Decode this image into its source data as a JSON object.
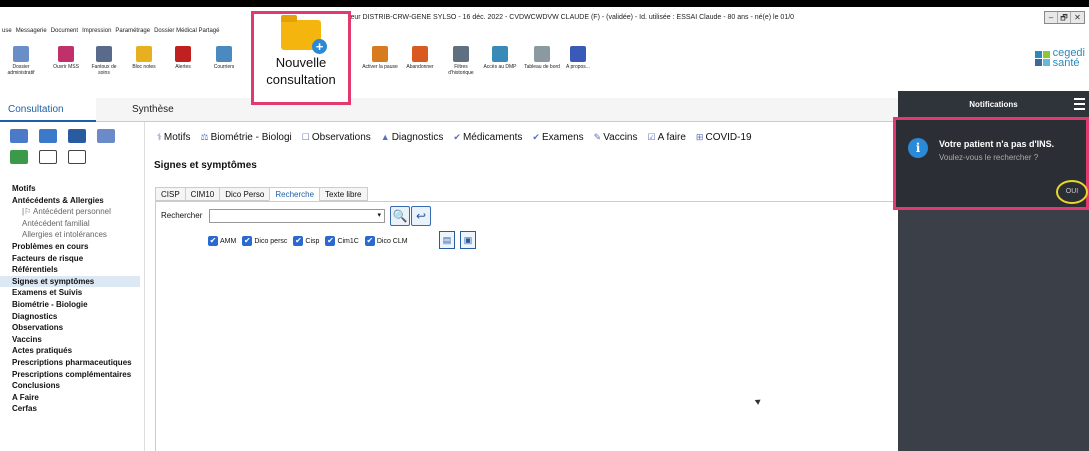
{
  "window": {
    "title": "cteur DISTRIB-CRW-GENE SYLSO - 16 déc. 2022 - CVDWCWDVW CLAUDE (F) - (validée) - Id. utilisée : ESSAI Claude - 80 ans - né(e) le 01/0",
    "controls": [
      "–",
      "🗗",
      "✕"
    ]
  },
  "menu": [
    "use",
    "Messagerie",
    "Document",
    "Impression",
    "Paramétrage",
    "Dossier Médical Partagé"
  ],
  "toolbar": {
    "tools": [
      {
        "label": "Dossier administratif",
        "color": "#6a8fc8"
      },
      {
        "label": "Ouvrir MSS",
        "color": "#c0306a"
      },
      {
        "label": "Fantoux de soins",
        "color": "#5a6a8a"
      },
      {
        "label": "Bloc notes",
        "color": "#e8b020"
      },
      {
        "label": "Alertes",
        "color": "#c02020"
      },
      {
        "label": "Courriers",
        "color": "#4a8ac0"
      },
      {
        "label": "Activer la pause",
        "color": "#d87a20"
      },
      {
        "label": "Abandonner",
        "color": "#d85a20"
      },
      {
        "label": "Filtres d'historique",
        "color": "#607080"
      },
      {
        "label": "Accès au DMP",
        "color": "#3a8ab8"
      },
      {
        "label": "Tableau de bord",
        "color": "#8a9aa0"
      },
      {
        "label": "A propos...",
        "color": "#3a5ab8"
      }
    ],
    "big_button_label": "Nouvelle consultation"
  },
  "logo": {
    "line1": "cegedi",
    "line2": "santé",
    "colors": [
      "#2a8ab8",
      "#8ac83a",
      "#3a6a9a",
      "#6ab8d8"
    ]
  },
  "tabs": {
    "consultation": "Consultation",
    "synthese": "Synthèse"
  },
  "left_list": [
    {
      "label": "Motifs",
      "style": "b"
    },
    {
      "label": "Antécédents & Allergies",
      "style": "b"
    },
    {
      "label": "|⚐ Antécédent personnel",
      "style": "sub"
    },
    {
      "label": "Antécédent familial",
      "style": "sub"
    },
    {
      "label": "Allergies et intolérances",
      "style": "sub"
    },
    {
      "label": "Problèmes en cours",
      "style": "b"
    },
    {
      "label": "Facteurs de risque",
      "style": "b"
    },
    {
      "label": "Référentiels",
      "style": "b"
    },
    {
      "label": "Signes et symptômes",
      "style": "b sel"
    },
    {
      "label": "Examens et Suivis",
      "style": "b"
    },
    {
      "label": "Biométrie - Biologie",
      "style": "b"
    },
    {
      "label": "Diagnostics",
      "style": "b"
    },
    {
      "label": "Observations",
      "style": "b"
    },
    {
      "label": "Vaccins",
      "style": "b"
    },
    {
      "label": "Actes pratiqués",
      "style": "b"
    },
    {
      "label": "Prescriptions pharmaceutiques",
      "style": "b"
    },
    {
      "label": "Prescriptions complémentaires",
      "style": "b"
    },
    {
      "label": "Conclusions",
      "style": "b"
    },
    {
      "label": "A Faire",
      "style": "b"
    },
    {
      "label": "Cerfas",
      "style": "b"
    }
  ],
  "categories": [
    {
      "icon": "⚕",
      "label": "Motifs"
    },
    {
      "icon": "⚖",
      "label": "Biométrie - Biologi"
    },
    {
      "icon": "☐",
      "label": "Observations"
    },
    {
      "icon": "▲",
      "label": "Diagnostics"
    },
    {
      "icon": "✔",
      "label": "Médicaments"
    },
    {
      "icon": "✔",
      "label": "Examens"
    },
    {
      "icon": "✎",
      "label": "Vaccins"
    },
    {
      "icon": "☑",
      "label": "A faire"
    },
    {
      "icon": "⊞",
      "label": "COVID-19"
    }
  ],
  "section_title": "Signes et symptômes",
  "sub_tabs": [
    "CISP",
    "CIM10",
    "Dico Perso",
    "Recherche",
    "Texte libre"
  ],
  "search": {
    "label": "Rechercher",
    "arrow": "▾",
    "search_glyph": "🔍",
    "back_glyph": "↩"
  },
  "checks": [
    "AMM",
    "Dico persc",
    "Cisp",
    "Cim1C",
    "Dico CLM"
  ],
  "check_glyph": "✔",
  "notifications": {
    "header": "Notifications",
    "title": "Votre patient n'a pas d'INS.",
    "message": "Voulez-vous le rechercher ?",
    "button": "OUI",
    "info_glyph": "i"
  }
}
